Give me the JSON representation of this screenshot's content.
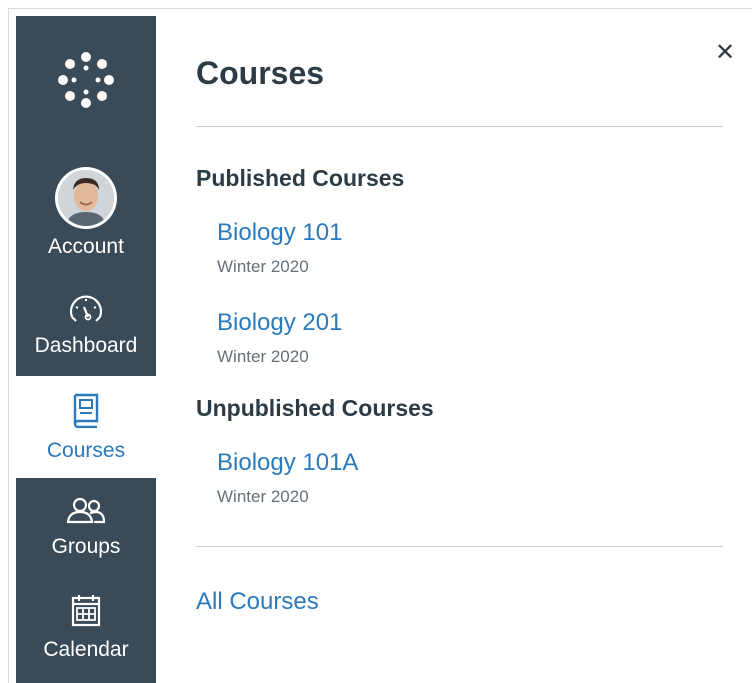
{
  "nav": {
    "logo_icon": "canvas-logo-icon",
    "items": [
      {
        "label": "Account",
        "icon": "avatar"
      },
      {
        "label": "Dashboard",
        "icon": "dashboard-gauge-icon"
      },
      {
        "label": "Courses",
        "icon": "courses-book-icon",
        "active": true
      },
      {
        "label": "Groups",
        "icon": "groups-people-icon"
      },
      {
        "label": "Calendar",
        "icon": "calendar-icon"
      }
    ]
  },
  "tray": {
    "title": "Courses",
    "close_icon": "close-icon",
    "published_heading": "Published Courses",
    "published": [
      {
        "name": "Biology 101",
        "term": "Winter 2020"
      },
      {
        "name": "Biology 201",
        "term": "Winter 2020"
      }
    ],
    "unpublished_heading": "Unpublished Courses",
    "unpublished": [
      {
        "name": "Biology 101A",
        "term": "Winter 2020"
      }
    ],
    "all_courses_label": "All Courses"
  },
  "colors": {
    "nav_bg": "#394b58",
    "link": "#2b7abc",
    "heading": "#2d3b45",
    "muted": "#66717a"
  }
}
